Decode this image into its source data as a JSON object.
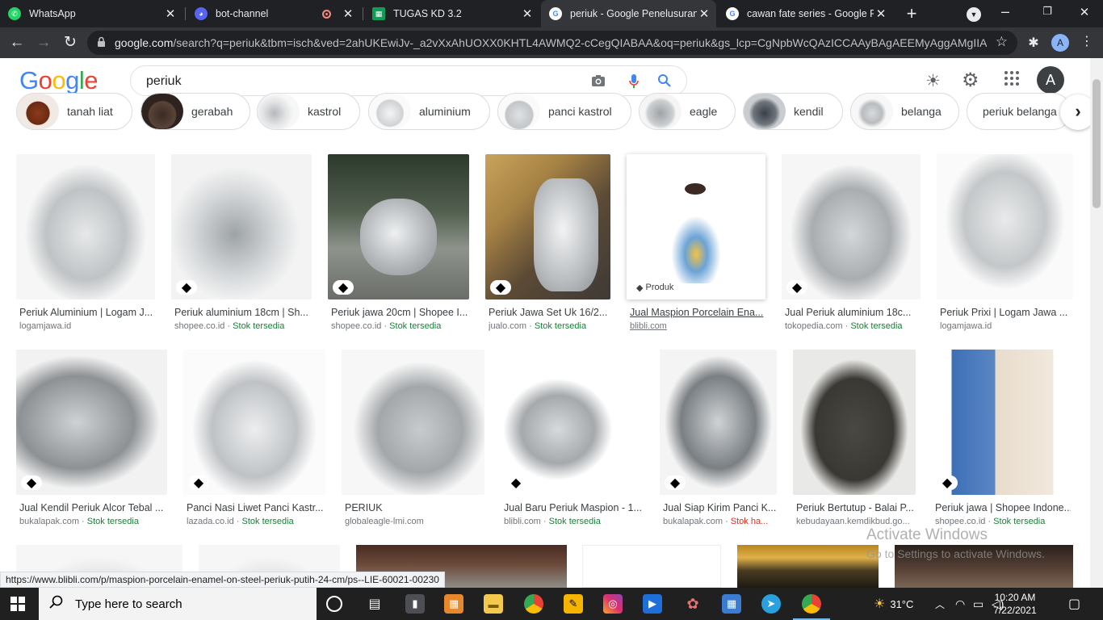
{
  "tabs": [
    {
      "title": "WhatsApp",
      "icon": "whatsapp-icon",
      "color": "#25d366"
    },
    {
      "title": "bot-channel",
      "icon": "discord-icon",
      "color": "#5865f2"
    },
    {
      "title": "TUGAS KD 3.2",
      "icon": "sheets-icon",
      "color": "#0f9d58"
    },
    {
      "title": "periuk - Google Penelusuran",
      "icon": "google-icon",
      "color": "#ffffff"
    },
    {
      "title": "cawan fate series - Google Pe",
      "icon": "google-icon",
      "color": "#ffffff"
    }
  ],
  "address": {
    "host": "google.com",
    "path": "/search?q=periuk&tbm=isch&ved=2ahUKEwiJv-_a2vXxAhUOXX0KHTL4AWMQ2-cCegQIABAA&oq=periuk&gs_lcp=CgNpbWcQAzICCAAyBAgAEEMyAggAMgIIA..."
  },
  "google": {
    "logo": "Google",
    "query": "periuk",
    "avatar": "A"
  },
  "chips": [
    "tanah liat",
    "gerabah",
    "kastrol",
    "aluminium",
    "panci kastrol",
    "eagle",
    "kendil",
    "belanga",
    "periuk belanga"
  ],
  "row1": [
    {
      "title": "Periuk Aluminium | Logam J...",
      "source": "logamjawa.id",
      "stock": ""
    },
    {
      "title": "Periuk aluminium 18cm | Sh...",
      "source": "shopee.co.id",
      "stock": "Stok tersedia"
    },
    {
      "title": "Periuk jawa 20cm | Shopee I...",
      "source": "shopee.co.id",
      "stock": "Stok tersedia"
    },
    {
      "title": "Periuk Jawa Set Uk 16/2...",
      "source": "jualo.com",
      "stock": "Stok tersedia"
    },
    {
      "title": "Jual Maspion Porcelain Ena...",
      "source": "blibli.com",
      "stock": "",
      "badge": "Produk"
    },
    {
      "title": "Jual Periuk aluminium 18c...",
      "source": "tokopedia.com",
      "stock": "Stok tersedia"
    },
    {
      "title": "Periuk Prixi | Logam Jawa ...",
      "source": "logamjawa.id",
      "stock": ""
    }
  ],
  "row2": [
    {
      "title": "Jual Kendil Periuk Alcor Tebal ...",
      "source": "bukalapak.com",
      "stock": "Stok tersedia"
    },
    {
      "title": "Panci Nasi Liwet Panci Kastr...",
      "source": "lazada.co.id",
      "stock": "Stok tersedia"
    },
    {
      "title": "PERIUK",
      "source": "globaleagle-lmi.com",
      "stock": ""
    },
    {
      "title": "Jual Baru Periuk Maspion - 1...",
      "source": "blibli.com",
      "stock": "Stok tersedia"
    },
    {
      "title": "Jual Siap Kirim Panci K...",
      "source": "bukalapak.com",
      "stock": "Stok ha...",
      "stock_warn": true
    },
    {
      "title": "Periuk Bertutup - Balai P...",
      "source": "kebudayaan.kemdikbud.go...",
      "stock": ""
    },
    {
      "title": "Periuk jawa | Shopee Indone...",
      "source": "shopee.co.id",
      "stock": "Stok tersedia"
    }
  ],
  "status_url": "https://www.blibli.com/p/maspion-porcelain-enamel-on-steel-periuk-putih-24-cm/ps--LIE-60021-00230",
  "watermark": {
    "line1": "Activate Windows",
    "line2": "Go to Settings to activate Windows."
  },
  "taskbar": {
    "search_placeholder": "Type here to search",
    "temperature": "31°C",
    "time": "10:20 AM",
    "date": "7/22/2021"
  }
}
